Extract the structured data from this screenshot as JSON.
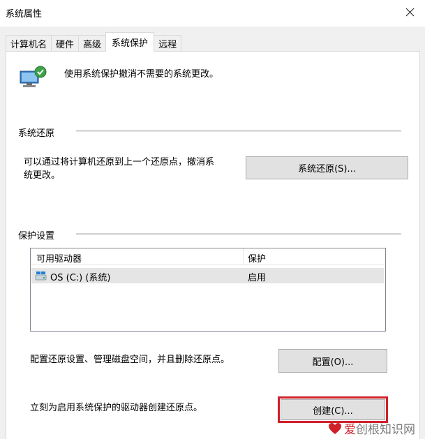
{
  "window": {
    "title": "系统属性"
  },
  "tabs": [
    {
      "label": "计算机名"
    },
    {
      "label": "硬件"
    },
    {
      "label": "高级"
    },
    {
      "label": "系统保护",
      "active": true
    },
    {
      "label": "远程"
    }
  ],
  "intro": {
    "text": "使用系统保护撤消不需要的系统更改。",
    "icon": "computer-shield-icon"
  },
  "restore": {
    "group_label": "系统还原",
    "desc_line1": "可以通过将计算机还原到上一个还原点，撤消系",
    "desc_line2": "统更改。",
    "button_label": "系统还原(S)..."
  },
  "protection": {
    "group_label": "保护设置",
    "columns": [
      "可用驱动器",
      "保护"
    ],
    "rows": [
      {
        "drive": "OS (C:) (系统)",
        "protection": "启用",
        "icon": "drive-icon"
      }
    ]
  },
  "configure": {
    "desc": "配置还原设置、管理磁盘空间，并且删除还原点。",
    "button_label": "配置(O)..."
  },
  "create": {
    "desc": "立刻为启用系统保护的驱动器创建还原点。",
    "button_label": "创建(C)..."
  },
  "watermark": {
    "part1": "爱",
    "part2": "创根",
    "part3": "知识网"
  },
  "colors": {
    "highlight": "#d0202a",
    "button": "#e1e1e1",
    "selected_row": "#e5e5e5"
  }
}
